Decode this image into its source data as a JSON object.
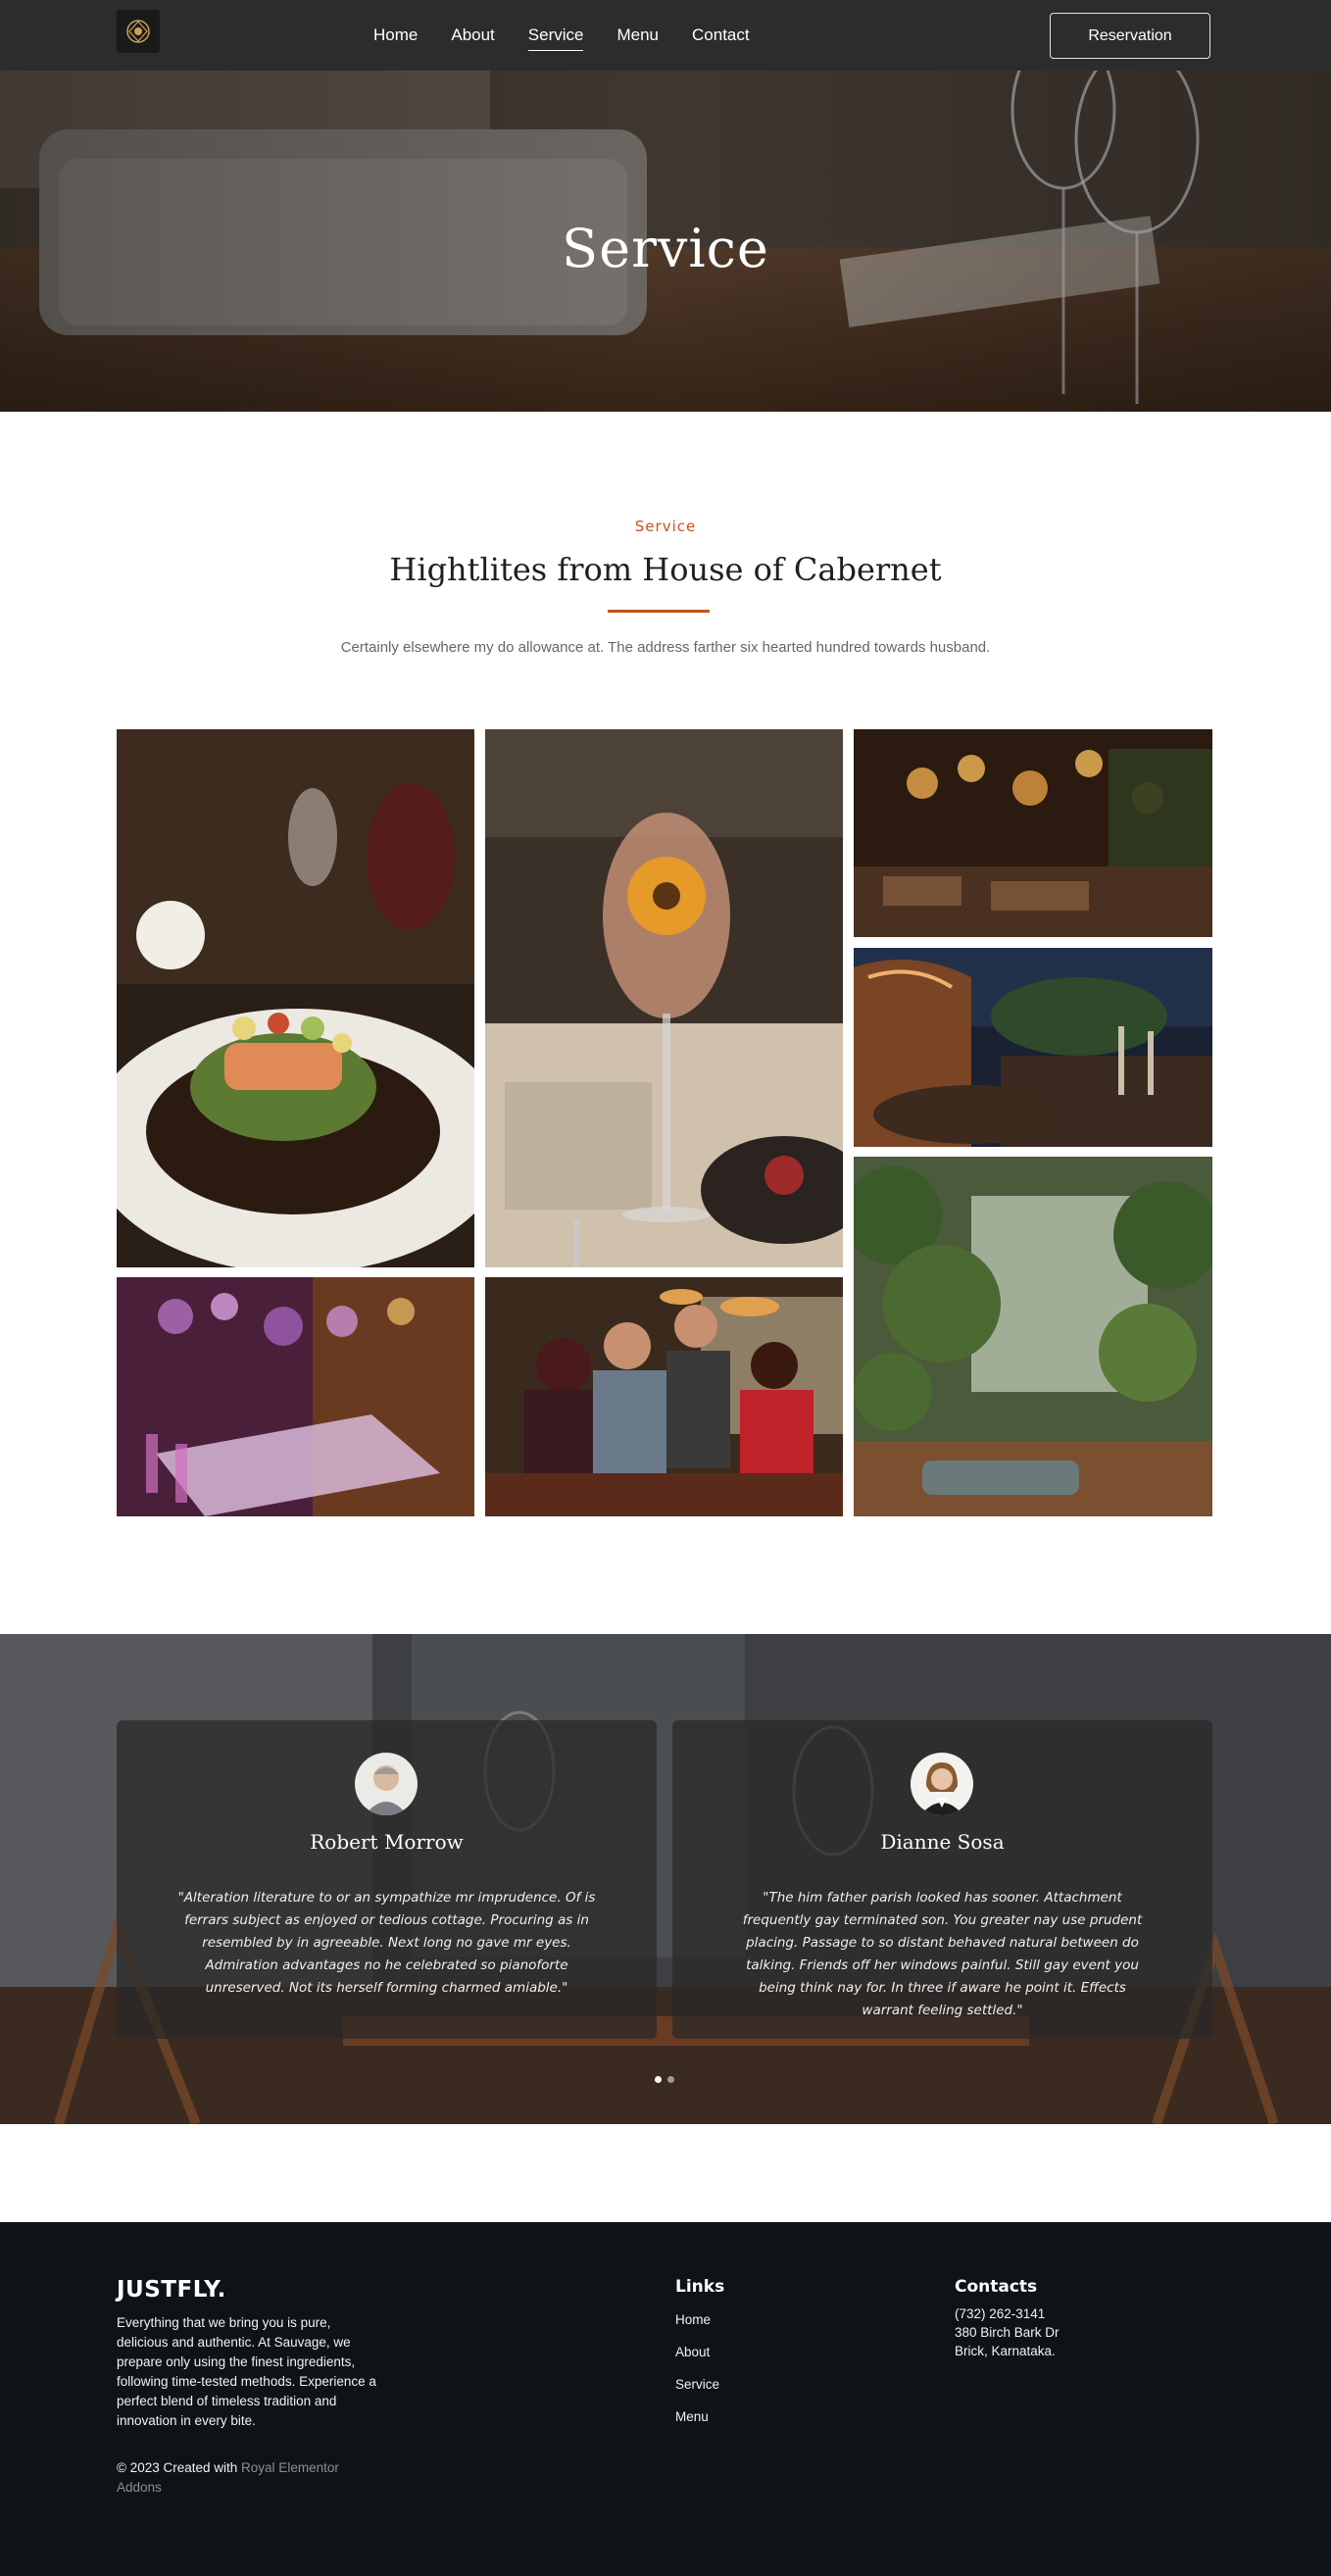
{
  "nav": {
    "items": [
      {
        "label": "Home",
        "active": false
      },
      {
        "label": "About",
        "active": false
      },
      {
        "label": "Service",
        "active": true
      },
      {
        "label": "Menu",
        "active": false
      },
      {
        "label": "Contact",
        "active": false
      }
    ],
    "reservation_label": "Reservation"
  },
  "hero": {
    "title": "Service"
  },
  "intro": {
    "eyebrow": "Service",
    "title": "Hightlites from House of Cabernet",
    "subtitle": "Certainly elsewhere my do allowance at. The address farther six hearted hundred towards husband."
  },
  "gallery": {
    "images": [
      "salmon-dish-photo",
      "wine-glass-sunflower-photo",
      "restaurant-interior-lamps-photo",
      "outdoor-terrace-night-photo",
      "plant-wall-lounge-photo",
      "purple-banquet-hall-photo",
      "waitress-serving-diners-photo"
    ]
  },
  "testimonials": {
    "items": [
      {
        "name": "Robert Morrow",
        "quote": "\"Alteration literature to or an sympathize mr imprudence. Of is ferrars subject as enjoyed or tedious cottage. Procuring as in resembled by in agreeable. Next long no gave mr eyes. Admiration advantages no he celebrated so pianoforte unreserved. Not its herself forming charmed amiable.\""
      },
      {
        "name": "Dianne Sosa",
        "quote": "\"The him father parish looked has sooner. Attachment frequently gay terminated son. You greater nay use prudent placing. Passage to so distant behaved natural between do talking. Friends off her windows painful. Still gay event you being think nay for. In three if aware he point it. Effects warrant feeling settled.\""
      }
    ],
    "active_slide": 1,
    "slide_count": 2
  },
  "footer": {
    "brand": "JUSTFLY.",
    "about": "Everything that we bring you is pure, delicious and authentic. At Sauvage, we prepare only using the finest ingredients, following time-tested methods. Experience a perfect blend of timeless tradition and innovation in every bite.",
    "copyright_prefix": "© 2023 Created with",
    "copyright_link": "Royal Elementor Addons",
    "links_heading": "Links",
    "links": [
      "Home",
      "About",
      "Service",
      "Menu"
    ],
    "contacts_heading": "Contacts",
    "contacts": [
      "(732) 262-3141",
      "380 Birch Bark Dr",
      "Brick, Karnataka."
    ]
  },
  "colors": {
    "accent": "#c7511f",
    "nav_bg": "#2c2c2c",
    "footer_bg": "#0f1317"
  }
}
